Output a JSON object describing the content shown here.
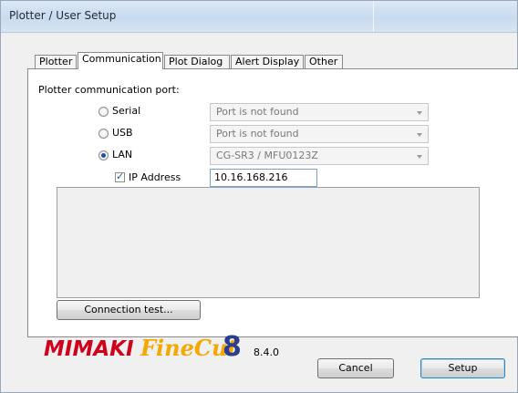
{
  "window": {
    "title": "Plotter / User Setup"
  },
  "tabs": [
    {
      "label": "Plotter",
      "active": false
    },
    {
      "label": "Communication",
      "active": true
    },
    {
      "label": "Plot Dialog",
      "active": false
    },
    {
      "label": "Alert Display",
      "active": false
    },
    {
      "label": "Other",
      "active": false
    }
  ],
  "panel": {
    "section_label": "Plotter communication port:",
    "ports": [
      {
        "label": "Serial",
        "selected": false,
        "value": "Port is not found"
      },
      {
        "label": "USB",
        "selected": false,
        "value": "Port is not found"
      },
      {
        "label": "LAN",
        "selected": true,
        "value": "CG-SR3 / MFU0123Z"
      }
    ],
    "ip": {
      "label": "IP Address",
      "checked": true,
      "value": "10.16.168.216"
    },
    "connection_test_label": "Connection test..."
  },
  "footer": {
    "brand": "MIMAKI",
    "product": "FineCut",
    "product_number": "8",
    "version": "8.4.0",
    "cancel_label": "Cancel",
    "setup_label": "Setup"
  },
  "colors": {
    "brand_red": "#d0021b",
    "finecut_orange": "#f5a800",
    "eight_blue": "#2a3d8f",
    "radio_dot": "#1d4f9c"
  }
}
